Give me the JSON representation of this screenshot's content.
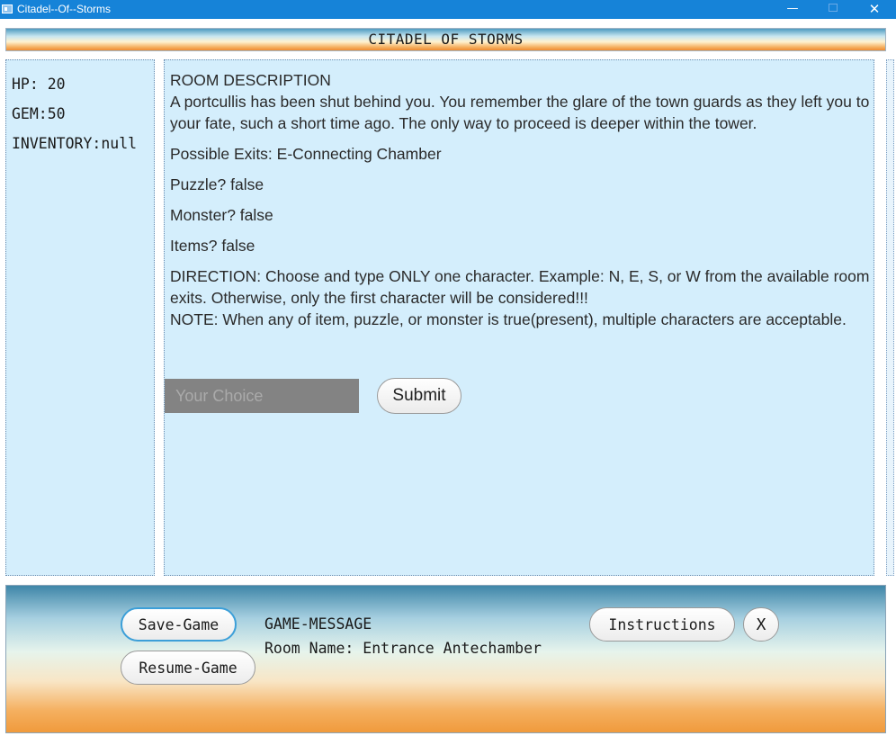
{
  "window": {
    "title": "Citadel--Of--Storms",
    "min_label": "—",
    "close_label": "✕"
  },
  "banner": {
    "title": "CITADEL OF STORMS"
  },
  "stats": {
    "hp": "HP: 20",
    "gem": "GEM:50",
    "inventory": "INVENTORY:null"
  },
  "room": {
    "heading": "ROOM DESCRIPTION",
    "description": "A portcullis has been shut behind you. You remember the glare of the town guards as they left you to your fate, such a short time ago. The only way to proceed is deeper within the tower.",
    "exits": "Possible Exits:  E-Connecting Chamber",
    "puzzle": "Puzzle? false",
    "monster": "Monster? false",
    "items": "Items? false",
    "direction": "DIRECTION: Choose and type ONLY one character. Example: N, E, S, or W from the available room exits. Otherwise, only the first character will be considered!!!",
    "note": "NOTE: When any of item, puzzle, or monster is true(present), multiple characters are acceptable."
  },
  "choice": {
    "value": "",
    "placeholder": "Your Choice",
    "submit_label": "Submit"
  },
  "bottom": {
    "save_label": "Save-Game",
    "resume_label": "Resume-Game",
    "message_title": "GAME-MESSAGE",
    "message_room": "Room Name: Entrance Antechamber",
    "instructions_label": "Instructions",
    "exit_label": "X"
  },
  "colors": {
    "titlebar": "#1683d8",
    "panel_bg": "#d4eefc",
    "input_bg": "#838383",
    "accent_border": "#3c9fd8"
  }
}
